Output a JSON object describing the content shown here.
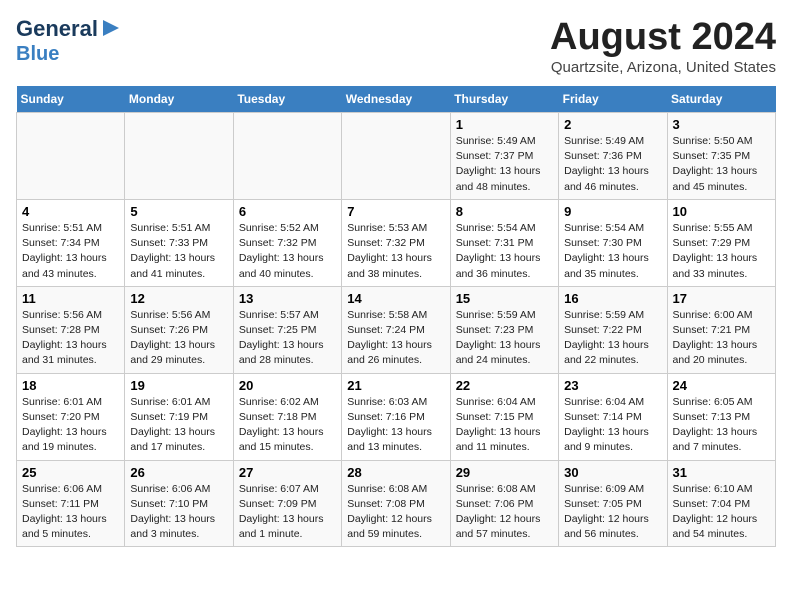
{
  "logo": {
    "line1": "General",
    "line2": "Blue"
  },
  "title": "August 2024",
  "subtitle": "Quartzsite, Arizona, United States",
  "weekdays": [
    "Sunday",
    "Monday",
    "Tuesday",
    "Wednesday",
    "Thursday",
    "Friday",
    "Saturday"
  ],
  "weeks": [
    [
      {
        "day": "",
        "info": ""
      },
      {
        "day": "",
        "info": ""
      },
      {
        "day": "",
        "info": ""
      },
      {
        "day": "",
        "info": ""
      },
      {
        "day": "1",
        "info": "Sunrise: 5:49 AM\nSunset: 7:37 PM\nDaylight: 13 hours\nand 48 minutes."
      },
      {
        "day": "2",
        "info": "Sunrise: 5:49 AM\nSunset: 7:36 PM\nDaylight: 13 hours\nand 46 minutes."
      },
      {
        "day": "3",
        "info": "Sunrise: 5:50 AM\nSunset: 7:35 PM\nDaylight: 13 hours\nand 45 minutes."
      }
    ],
    [
      {
        "day": "4",
        "info": "Sunrise: 5:51 AM\nSunset: 7:34 PM\nDaylight: 13 hours\nand 43 minutes."
      },
      {
        "day": "5",
        "info": "Sunrise: 5:51 AM\nSunset: 7:33 PM\nDaylight: 13 hours\nand 41 minutes."
      },
      {
        "day": "6",
        "info": "Sunrise: 5:52 AM\nSunset: 7:32 PM\nDaylight: 13 hours\nand 40 minutes."
      },
      {
        "day": "7",
        "info": "Sunrise: 5:53 AM\nSunset: 7:32 PM\nDaylight: 13 hours\nand 38 minutes."
      },
      {
        "day": "8",
        "info": "Sunrise: 5:54 AM\nSunset: 7:31 PM\nDaylight: 13 hours\nand 36 minutes."
      },
      {
        "day": "9",
        "info": "Sunrise: 5:54 AM\nSunset: 7:30 PM\nDaylight: 13 hours\nand 35 minutes."
      },
      {
        "day": "10",
        "info": "Sunrise: 5:55 AM\nSunset: 7:29 PM\nDaylight: 13 hours\nand 33 minutes."
      }
    ],
    [
      {
        "day": "11",
        "info": "Sunrise: 5:56 AM\nSunset: 7:28 PM\nDaylight: 13 hours\nand 31 minutes."
      },
      {
        "day": "12",
        "info": "Sunrise: 5:56 AM\nSunset: 7:26 PM\nDaylight: 13 hours\nand 29 minutes."
      },
      {
        "day": "13",
        "info": "Sunrise: 5:57 AM\nSunset: 7:25 PM\nDaylight: 13 hours\nand 28 minutes."
      },
      {
        "day": "14",
        "info": "Sunrise: 5:58 AM\nSunset: 7:24 PM\nDaylight: 13 hours\nand 26 minutes."
      },
      {
        "day": "15",
        "info": "Sunrise: 5:59 AM\nSunset: 7:23 PM\nDaylight: 13 hours\nand 24 minutes."
      },
      {
        "day": "16",
        "info": "Sunrise: 5:59 AM\nSunset: 7:22 PM\nDaylight: 13 hours\nand 22 minutes."
      },
      {
        "day": "17",
        "info": "Sunrise: 6:00 AM\nSunset: 7:21 PM\nDaylight: 13 hours\nand 20 minutes."
      }
    ],
    [
      {
        "day": "18",
        "info": "Sunrise: 6:01 AM\nSunset: 7:20 PM\nDaylight: 13 hours\nand 19 minutes."
      },
      {
        "day": "19",
        "info": "Sunrise: 6:01 AM\nSunset: 7:19 PM\nDaylight: 13 hours\nand 17 minutes."
      },
      {
        "day": "20",
        "info": "Sunrise: 6:02 AM\nSunset: 7:18 PM\nDaylight: 13 hours\nand 15 minutes."
      },
      {
        "day": "21",
        "info": "Sunrise: 6:03 AM\nSunset: 7:16 PM\nDaylight: 13 hours\nand 13 minutes."
      },
      {
        "day": "22",
        "info": "Sunrise: 6:04 AM\nSunset: 7:15 PM\nDaylight: 13 hours\nand 11 minutes."
      },
      {
        "day": "23",
        "info": "Sunrise: 6:04 AM\nSunset: 7:14 PM\nDaylight: 13 hours\nand 9 minutes."
      },
      {
        "day": "24",
        "info": "Sunrise: 6:05 AM\nSunset: 7:13 PM\nDaylight: 13 hours\nand 7 minutes."
      }
    ],
    [
      {
        "day": "25",
        "info": "Sunrise: 6:06 AM\nSunset: 7:11 PM\nDaylight: 13 hours\nand 5 minutes."
      },
      {
        "day": "26",
        "info": "Sunrise: 6:06 AM\nSunset: 7:10 PM\nDaylight: 13 hours\nand 3 minutes."
      },
      {
        "day": "27",
        "info": "Sunrise: 6:07 AM\nSunset: 7:09 PM\nDaylight: 13 hours\nand 1 minute."
      },
      {
        "day": "28",
        "info": "Sunrise: 6:08 AM\nSunset: 7:08 PM\nDaylight: 12 hours\nand 59 minutes."
      },
      {
        "day": "29",
        "info": "Sunrise: 6:08 AM\nSunset: 7:06 PM\nDaylight: 12 hours\nand 57 minutes."
      },
      {
        "day": "30",
        "info": "Sunrise: 6:09 AM\nSunset: 7:05 PM\nDaylight: 12 hours\nand 56 minutes."
      },
      {
        "day": "31",
        "info": "Sunrise: 6:10 AM\nSunset: 7:04 PM\nDaylight: 12 hours\nand 54 minutes."
      }
    ]
  ]
}
